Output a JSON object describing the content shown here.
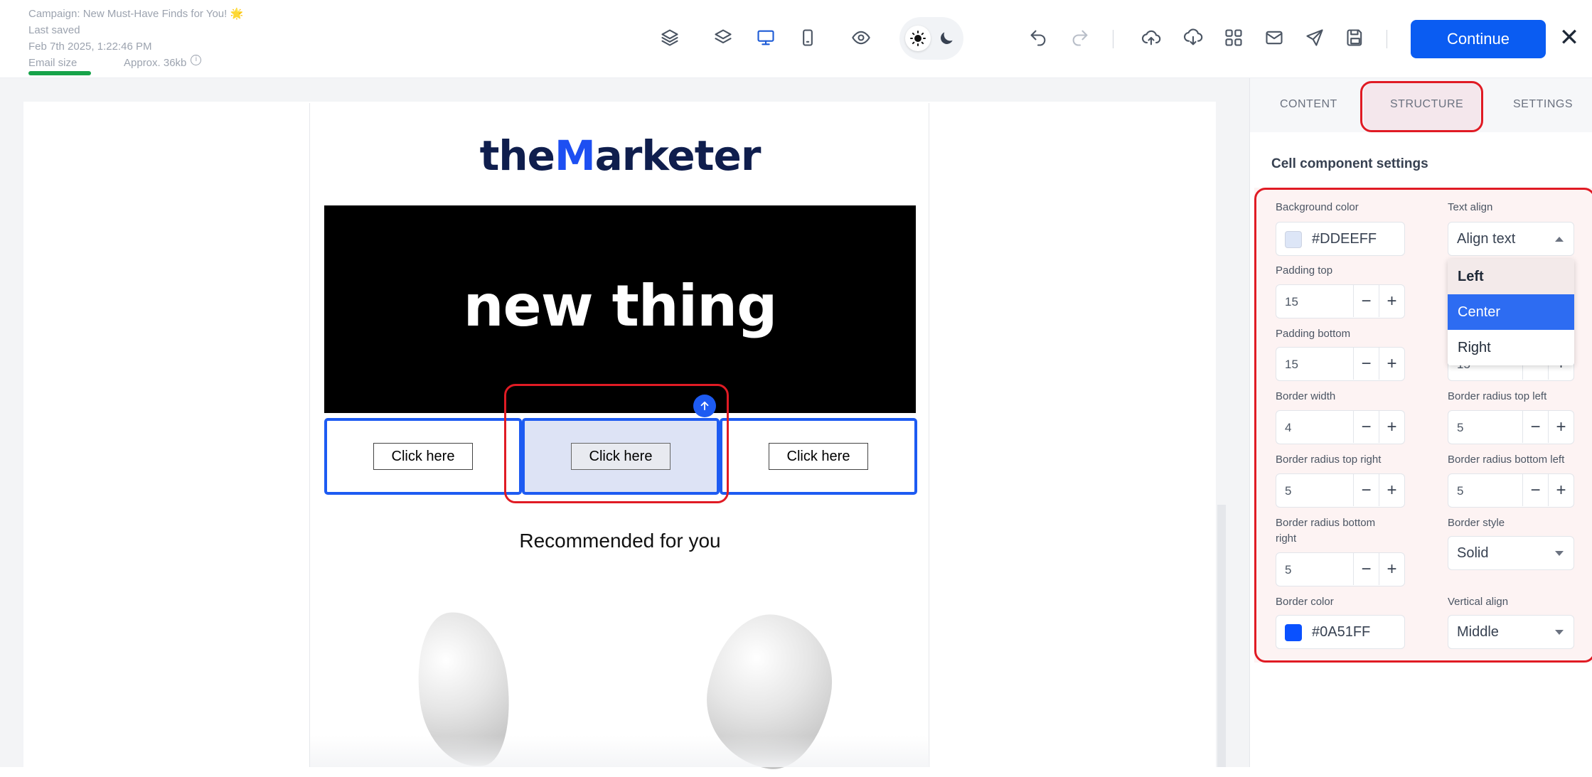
{
  "header": {
    "campaign": "Campaign: New Must-Have Finds for You! 🌟",
    "last_saved_label": "Last saved",
    "timestamp": "Feb 7th 2025, 1:22:46 PM",
    "email_size_label": "Email size",
    "approx_size": "Approx. 36kb",
    "continue_label": "Continue",
    "close_glyph": "✕"
  },
  "toolbar_icons": [
    "layers-stack-icon",
    "layers-icon",
    "desktop-icon",
    "mobile-icon",
    "preview-eye-icon",
    "sun-icon",
    "moon-icon",
    "undo-icon",
    "redo-icon",
    "upload-icon",
    "download-icon",
    "grid-icon",
    "mail-icon",
    "send-icon",
    "save-icon"
  ],
  "email": {
    "logo_pre": "the",
    "logo_m": "M",
    "logo_post": "arketer",
    "hero_text": "new thing",
    "cells": [
      {
        "button": "Click here"
      },
      {
        "button": "Click here"
      },
      {
        "button": "Click here"
      }
    ],
    "recommended_title": "Recommended for you"
  },
  "panel": {
    "tabs": [
      "CONTENT",
      "STRUCTURE",
      "SETTINGS"
    ],
    "active_tab": "STRUCTURE",
    "title": "Cell component settings",
    "background_color": {
      "label": "Background color",
      "value": "#DDEEFF",
      "swatch": "#DDE6F7"
    },
    "text_align": {
      "label": "Text align",
      "value": "Align text",
      "options": [
        "Left",
        "Center",
        "Right"
      ],
      "selected": "Center",
      "hovered": "Left"
    },
    "padding_top": {
      "label": "Padding top",
      "value": "15"
    },
    "padding_bottom": {
      "label": "Padding bottom",
      "value": "15"
    },
    "right_hidden_value": "15",
    "border_width": {
      "label": "Border width",
      "value": "4"
    },
    "border_radius_top_left": {
      "label": "Border radius top left",
      "value": "5"
    },
    "border_radius_top_right": {
      "label": "Border radius top right",
      "value": "5"
    },
    "border_radius_bottom_left": {
      "label": "Border radius bottom left",
      "value": "5"
    },
    "border_radius_bottom_right": {
      "label": "Border radius bottom right",
      "value": "5"
    },
    "border_style": {
      "label": "Border style",
      "value": "Solid"
    },
    "border_color": {
      "label": "Border color",
      "value": "#0A51FF",
      "swatch": "#0A51FF"
    },
    "vertical_align": {
      "label": "Vertical align",
      "value": "Middle"
    },
    "minus": "−",
    "plus": "+"
  },
  "colors": {
    "accent": "#0A5CF2",
    "highlight": "#E01B24",
    "cell_border": "#1D5BF2"
  }
}
